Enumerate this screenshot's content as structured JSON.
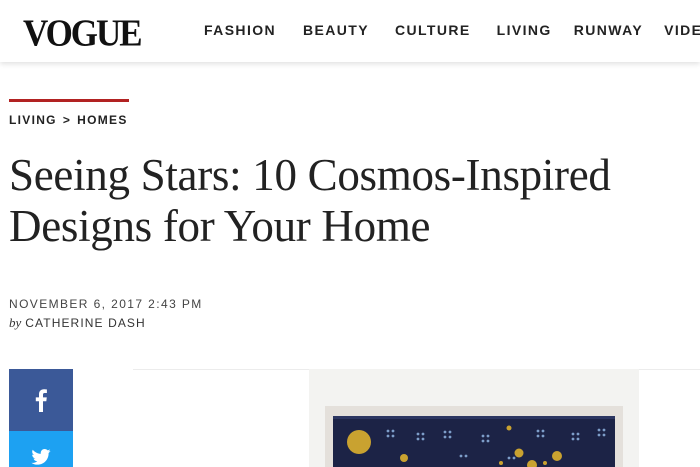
{
  "header": {
    "logo": "VOGUE",
    "nav": [
      "FASHION",
      "BEAUTY",
      "CULTURE",
      "LIVING",
      "RUNWAY",
      "VIDEO"
    ]
  },
  "breadcrumb": {
    "section": "LIVING",
    "separator": ">",
    "subsection": "HOMES"
  },
  "article": {
    "title": "Seeing Stars: 10 Cosmos-Inspired Designs for Your Home",
    "date": "NOVEMBER 6, 2017 2:43 PM",
    "by_prefix": "by",
    "author": "CATHERINE DASH"
  },
  "social": {
    "facebook_icon": "facebook-icon",
    "twitter_icon": "twitter-icon"
  },
  "colors": {
    "accent": "#b22222",
    "facebook": "#3b5998",
    "twitter": "#1da1f2",
    "quilt_indigo": "#1c2346",
    "gold": "#c9a230"
  }
}
